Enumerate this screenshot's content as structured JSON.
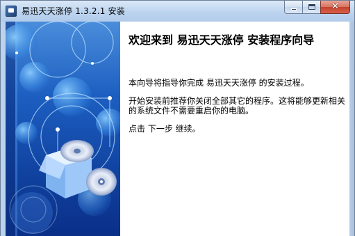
{
  "window": {
    "title": "易迅天天涨停 1.3.2.1 安装"
  },
  "title_buttons": {
    "minimize_icon": "minimize-icon",
    "maximize_icon": "maximize-icon",
    "close_icon": "close-icon",
    "close_glyph": "✕"
  },
  "wizard": {
    "heading": "欢迎来到 易迅天天涨停 安装程序向导",
    "paragraphs": [
      "本向导将指导你完成 易迅天天涨停 的安装过程。",
      "开始安装前推荐你关闭全部其它的程序。这将能够更新相关的系统文件不需要重启你的电脑。",
      "点击 下一步 继续。"
    ]
  },
  "banner": {
    "graphic": "cd-install-banner",
    "colors": {
      "top": "#3a7fd0",
      "mid": "#1449a8",
      "bottom": "#0a2f88"
    }
  }
}
